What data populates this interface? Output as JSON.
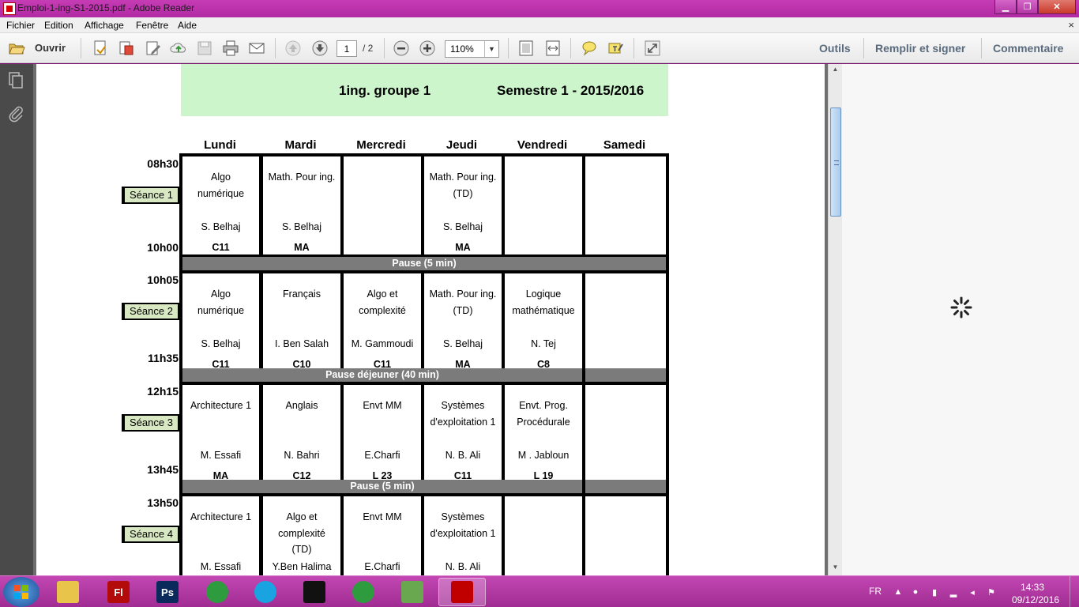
{
  "window": {
    "title": "Emploi-1-ing-S1-2015.pdf - Adobe Reader"
  },
  "menu": {
    "items": [
      "Fichier",
      "Edition",
      "Affichage",
      "Fenêtre",
      "Aide"
    ],
    "close": "×"
  },
  "toolbar": {
    "open_label": "Ouvrir",
    "page_current": "1",
    "page_total": "/ 2",
    "zoom": "110%",
    "tools": "Outils",
    "fill_sign": "Remplir et signer",
    "comment": "Commentaire"
  },
  "document": {
    "group": "1ing.  groupe 1",
    "semester": "Semestre 1 -  2015/2016",
    "days": [
      "Lundi",
      "Mardi",
      "Mercredi",
      "Jeudi",
      "Vendredi",
      "Samedi"
    ],
    "sessions": [
      {
        "label": "Séance 1",
        "start": "08h30",
        "end": "10h00",
        "cells": [
          {
            "subject": "Algo\nnumérique",
            "prof": "S. Belhaj",
            "room": "C11"
          },
          {
            "subject": "Math. Pour ing.",
            "prof": "S. Belhaj",
            "room": "MA"
          },
          {
            "subject": "",
            "prof": "",
            "room": ""
          },
          {
            "subject": "Math. Pour ing.\n(TD)",
            "prof": "S. Belhaj",
            "room": "MA"
          },
          {
            "subject": "",
            "prof": "",
            "room": ""
          },
          {
            "subject": "",
            "prof": "",
            "room": ""
          }
        ],
        "pause_after": "Pause  (5 min)"
      },
      {
        "label": "Séance 2",
        "start": "10h05",
        "end": "11h35",
        "cells": [
          {
            "subject": "Algo\nnumérique",
            "prof": "S. Belhaj",
            "room": "C11"
          },
          {
            "subject": "Français",
            "prof": "I. Ben Salah",
            "room": "C10"
          },
          {
            "subject": "Algo et\ncomplexité",
            "prof": "M. Gammoudi",
            "room": "C11"
          },
          {
            "subject": "Math. Pour ing.\n(TD)",
            "prof": "S. Belhaj",
            "room": "MA"
          },
          {
            "subject": "Logique\nmathématique",
            "prof": "N. Tej",
            "room": "C8"
          },
          {
            "subject": "",
            "prof": "",
            "room": ""
          }
        ],
        "pause_after": "Pause déjeuner (40 min)"
      },
      {
        "label": "Séance 3",
        "start": "12h15",
        "end": "13h45",
        "cells": [
          {
            "subject": "Architecture 1",
            "prof": "M. Essafi",
            "room": "MA"
          },
          {
            "subject": "Anglais",
            "prof": "N. Bahri",
            "room": "C12"
          },
          {
            "subject": "Envt MM",
            "prof": "E.Charfi",
            "room": "L 23"
          },
          {
            "subject": "Systèmes\nd'exploitation 1",
            "prof": "N. B. Ali",
            "room": "C11"
          },
          {
            "subject": "Envt. Prog.\nProcédurale",
            "prof": "M . Jabloun",
            "room": "L 19"
          },
          {
            "subject": "",
            "prof": "",
            "room": ""
          }
        ],
        "pause_after": "Pause (5 min)"
      },
      {
        "label": "Séance 4",
        "start": "13h50",
        "end": "",
        "cells": [
          {
            "subject": "Architecture 1",
            "prof": "M. Essafi",
            "room": ""
          },
          {
            "subject": "Algo et\ncomplexité\n(TD)",
            "prof": "Y.Ben Halima",
            "room": ""
          },
          {
            "subject": "Envt MM",
            "prof": "E.Charfi",
            "room": ""
          },
          {
            "subject": "Systèmes\nd'exploitation 1",
            "prof": "N. B. Ali",
            "room": ""
          },
          {
            "subject": "",
            "prof": "",
            "room": ""
          },
          {
            "subject": "",
            "prof": "",
            "room": ""
          }
        ],
        "pause_after": ""
      }
    ]
  },
  "taskbar": {
    "apps": [
      {
        "name": "file-explorer-icon",
        "label": "",
        "color": "#e8c44a"
      },
      {
        "name": "flash-icon",
        "label": "Fl",
        "color": "#b30a0a"
      },
      {
        "name": "photoshop-icon",
        "label": "Ps",
        "color": "#0a2a5c"
      },
      {
        "name": "chrome-icon",
        "label": "",
        "color": "#2e9b3e"
      },
      {
        "name": "skype-icon",
        "label": "",
        "color": "#19a3e0"
      },
      {
        "name": "cmd-icon",
        "label": "",
        "color": "#111111"
      },
      {
        "name": "chrome-icon",
        "label": "",
        "color": "#2e9b3e"
      },
      {
        "name": "notepad-plus-icon",
        "label": "",
        "color": "#6aa84f"
      },
      {
        "name": "adobe-reader-icon",
        "label": "",
        "color": "#c00000"
      }
    ],
    "lang": "FR",
    "time": "14:33",
    "date": "09/12/2016"
  }
}
